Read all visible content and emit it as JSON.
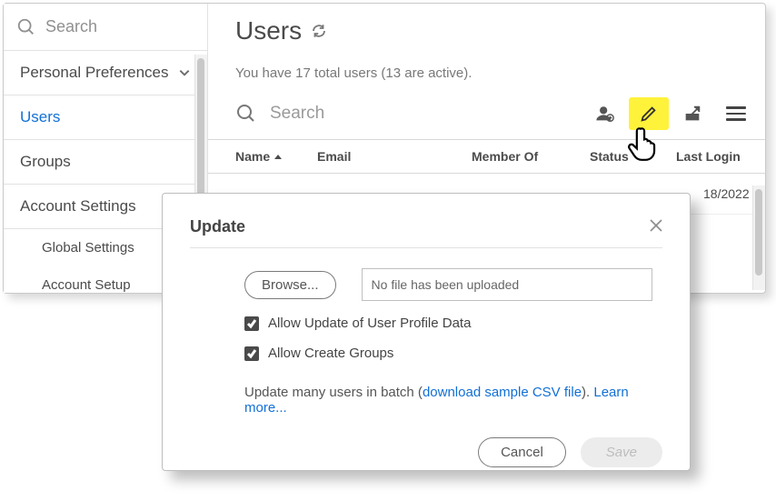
{
  "sidebar": {
    "search_placeholder": "Search",
    "items": [
      {
        "label": "Personal Preferences"
      },
      {
        "label": "Users"
      },
      {
        "label": "Groups"
      },
      {
        "label": "Account Settings"
      }
    ],
    "sub_items": [
      {
        "label": "Global Settings"
      },
      {
        "label": "Account Setup"
      }
    ]
  },
  "main": {
    "title": "Users",
    "status_line": "You have 17 total users (13 are active).",
    "toolbar_search_placeholder": "Search",
    "columns": {
      "name": "Name",
      "email": "Email",
      "member_of": "Member Of",
      "status": "Status",
      "last_login": "Last Login"
    },
    "rows": [
      {
        "last_login": "18/2022"
      }
    ]
  },
  "dialog": {
    "title": "Update",
    "browse_label": "Browse...",
    "file_status": "No file has been uploaded",
    "opt_profile": "Allow Update of User Profile Data",
    "opt_groups": "Allow Create Groups",
    "hint_prefix": "Update many users in batch (",
    "hint_link": "download sample CSV file",
    "hint_mid": "). ",
    "hint_learn": "Learn more...",
    "cancel": "Cancel",
    "save": "Save"
  }
}
